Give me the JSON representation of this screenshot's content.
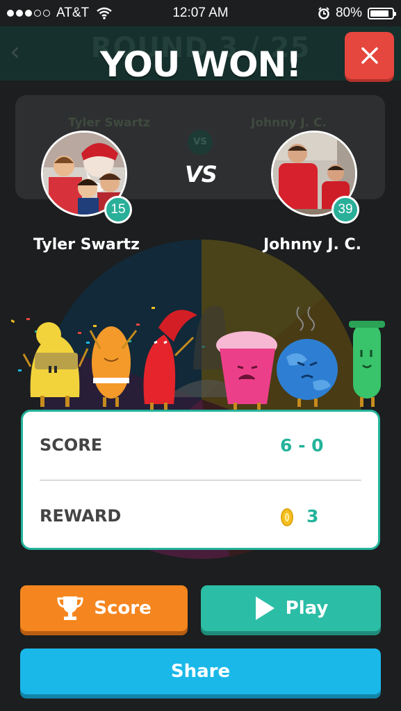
{
  "status_bar": {
    "carrier": "AT&T",
    "time": "12:07 AM",
    "battery": "80%",
    "battery_level": 0.8
  },
  "background": {
    "round": "ROUND 3 / 25",
    "player1": "Tyler Swartz",
    "player2": "Johnny J. C.",
    "vs": "VS"
  },
  "header": {
    "title": "YOU WON!",
    "close_icon": "close-icon"
  },
  "players": {
    "vs_label": "VS",
    "left": {
      "name": "Tyler Swartz",
      "level": "15"
    },
    "right": {
      "name": "Johnny J. C.",
      "level": "39"
    }
  },
  "result": {
    "score_label": "SCORE",
    "score_value": "6 - 0",
    "reward_label": "REWARD",
    "reward_value": "3",
    "reward_icon": "coin-icon"
  },
  "buttons": {
    "score": {
      "label": "Score",
      "icon": "trophy-icon"
    },
    "play": {
      "label": "Play",
      "icon": "play-icon"
    },
    "share": {
      "label": "Share"
    }
  },
  "colors": {
    "accent_teal": "#2cbda6",
    "score_orange": "#f5861f",
    "share_blue": "#1ab8e8",
    "close_red": "#e5463e"
  }
}
